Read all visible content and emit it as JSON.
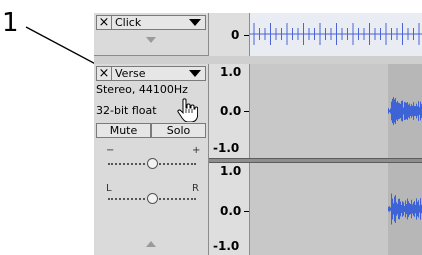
{
  "callout": {
    "number": "1"
  },
  "click_track": {
    "close_symbol": "×",
    "name": "Click",
    "ruler_label": "0",
    "collapse_icon": "triangle-down",
    "clip_color": "#4a63d8"
  },
  "verse_track": {
    "close_symbol": "×",
    "name": "Verse",
    "format": "Stereo, 44100Hz",
    "bit_depth": "32-bit float",
    "mute_label": "Mute",
    "solo_label": "Solo",
    "gain": {
      "minus": "−",
      "plus": "+",
      "level": 0.5
    },
    "pan": {
      "left": "L",
      "right": "R",
      "level": 0.5
    },
    "ruler_top": [
      "1.0",
      "0.0",
      "-1.0"
    ],
    "ruler_bottom": [
      "1.0",
      "0.0",
      "-1.0"
    ],
    "waveform_color": "#3d63d6"
  },
  "colors": {
    "panel": "#dadada",
    "track_bg": "#c8c8c8",
    "selection": "#b7b7b7"
  }
}
